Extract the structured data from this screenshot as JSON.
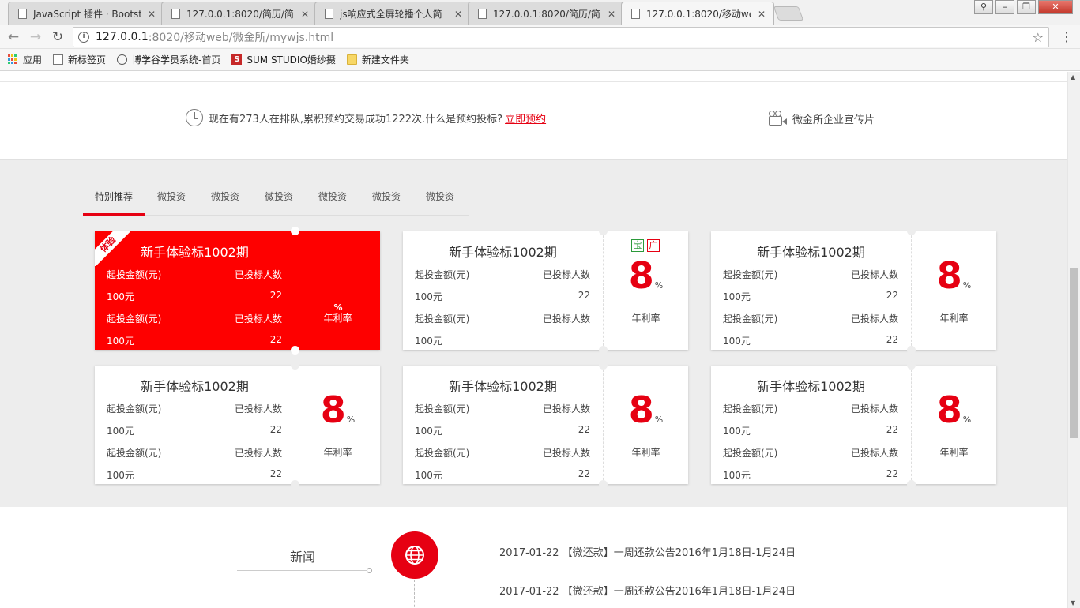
{
  "browser": {
    "tabs": [
      {
        "label": "JavaScript 插件 · Bootst",
        "active": false
      },
      {
        "label": "127.0.0.1:8020/简历/简",
        "active": false
      },
      {
        "label": "js响应式全屏轮播个人简",
        "active": false
      },
      {
        "label": "127.0.0.1:8020/简历/简",
        "active": false
      },
      {
        "label": "127.0.0.1:8020/移动we",
        "active": true
      }
    ],
    "url_host": "127.0.0.1",
    "url_path": ":8020/移动web/微金所/mywjs.html",
    "bookmarks": [
      "应用",
      "新标签页",
      "博学谷学员系统-首页",
      "SUM STUDIO婚纱摄",
      "新建文件夹"
    ]
  },
  "info": {
    "queue_text": "现在有273人在排队,累积预约交易成功1222次.什么是预约投标?",
    "queue_link": "立即预约",
    "promo_text": "微金所企业宣传片"
  },
  "product_tabs": [
    "特别推荐",
    "微投资",
    "微投资",
    "微投资",
    "微投资",
    "微投资",
    "微投资"
  ],
  "cards": [
    {
      "title": "新手体验标1002期",
      "ribbon": "体验",
      "label_amount": "起投金额(元)",
      "label_count": "已投标人数",
      "amount": "100元",
      "count": "22",
      "rate": "",
      "unit": "%",
      "rate_label": "年利率",
      "highlight": true
    },
    {
      "title": "新手体验标1002期",
      "label_amount": "起投金额(元)",
      "label_count": "已投标人数",
      "amount": "100元",
      "count": "",
      "rate": "8",
      "unit": "%",
      "rate_label": "年利率",
      "badges": [
        "宝",
        "广"
      ]
    },
    {
      "title": "新手体验标1002期",
      "label_amount": "起投金额(元)",
      "label_count": "已投标人数",
      "amount": "100元",
      "count": "22",
      "rate": "8",
      "unit": "%",
      "rate_label": "年利率"
    },
    {
      "title": "新手体验标1002期",
      "label_amount": "起投金额(元)",
      "label_count": "已投标人数",
      "amount": "100元",
      "count": "22",
      "rate": "8",
      "unit": "%",
      "rate_label": "年利率"
    },
    {
      "title": "新手体验标1002期",
      "label_amount": "起投金额(元)",
      "label_count": "已投标人数",
      "amount": "100元",
      "count": "22",
      "rate": "8",
      "unit": "%",
      "rate_label": "年利率"
    },
    {
      "title": "新手体验标1002期",
      "label_amount": "起投金额(元)",
      "label_count": "已投标人数",
      "amount": "100元",
      "count": "22",
      "rate": "8",
      "unit": "%",
      "rate_label": "年利率"
    }
  ],
  "news": {
    "title": "新闻",
    "items": [
      {
        "date": "2017-01-22",
        "text": "【微还款】一周还款公告2016年1月18日-1月24日"
      },
      {
        "date": "2017-01-22",
        "text": "【微还款】一周还款公告2016年1月18日-1月24日"
      }
    ]
  },
  "colors": {
    "accent": "#e60012",
    "card_highlight": "#fe0000",
    "section_bg": "#ededed",
    "badge_green": "#2b9a3a"
  }
}
